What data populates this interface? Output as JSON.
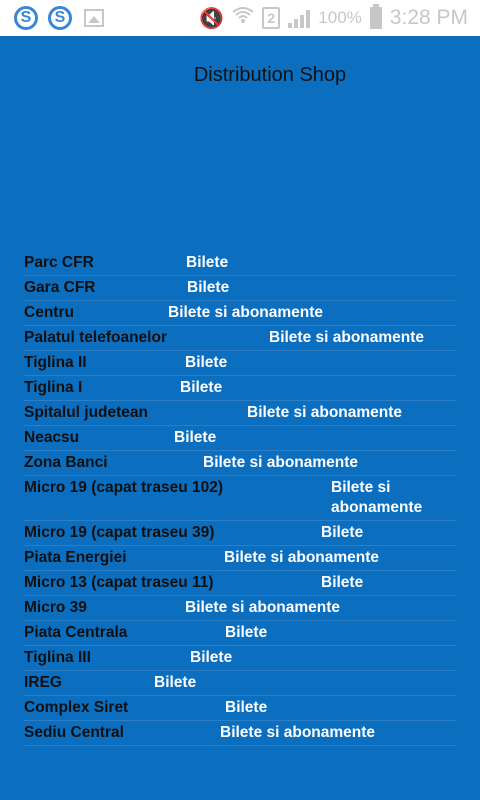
{
  "status_bar": {
    "battery_percent": "100%",
    "time": "3:28 PM",
    "sim_slot": "2",
    "icons": [
      "skype-icon",
      "skype-icon",
      "image-icon",
      "mute-icon",
      "wifi-icon",
      "sim-icon",
      "signal-icon",
      "battery-icon"
    ]
  },
  "header": {
    "title": "Distribution Shop"
  },
  "locations": [
    {
      "name": "Parc CFR",
      "type": "Bilete"
    },
    {
      "name": "Gara CFR",
      "type": "Bilete"
    },
    {
      "name": "Centru",
      "type": "Bilete si abonamente"
    },
    {
      "name": "Palatul telefoanelor",
      "type": "Bilete si abonamente"
    },
    {
      "name": "Tiglina II",
      "type": "Bilete"
    },
    {
      "name": "Tiglina I",
      "type": "Bilete"
    },
    {
      "name": "Spitalul judetean",
      "type": "Bilete si abonamente"
    },
    {
      "name": "Neacsu",
      "type": "Bilete"
    },
    {
      "name": "Zona Banci",
      "type": "Bilete si abonamente"
    },
    {
      "name": "Micro 19 (capat traseu 102)",
      "type": "Bilete si abonamente"
    },
    {
      "name": "Micro 19 (capat traseu 39)",
      "type": "Bilete"
    },
    {
      "name": "Piata Energiei",
      "type": "Bilete si abonamente"
    },
    {
      "name": "Micro 13 (capat traseu 11)",
      "type": "Bilete"
    },
    {
      "name": "Micro 39",
      "type": "Bilete si abonamente"
    },
    {
      "name": "Piata Centrala",
      "type": "Bilete"
    },
    {
      "name": "Tiglina III",
      "type": "Bilete"
    },
    {
      "name": "IREG",
      "type": "Bilete"
    },
    {
      "name": "Complex Siret",
      "type": "Bilete"
    },
    {
      "name": "Sediu Central",
      "type": "Bilete si abonamente"
    }
  ],
  "colors": {
    "background": "#0b6ebf",
    "status_bar": "#ffffff",
    "name_text": "#101010",
    "type_text": "#ffffff"
  }
}
